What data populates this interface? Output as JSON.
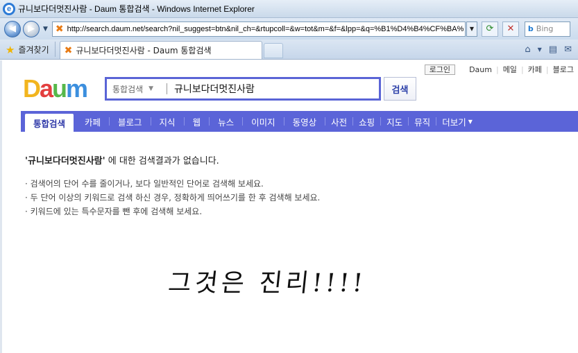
{
  "browser": {
    "window_title": "규니보다더멋진사람 - Daum 통합검색 - Windows Internet Explorer",
    "address": "http://search.daum.net/search?nil_suggest=btn&nil_ch=&rtupcoll=&w=tot&m=&f=&lpp=&q=%B1%D4%B4%CF%BA%",
    "search_placeholder": "Bing",
    "favorites_label": "즐겨찾기",
    "tab_title": "규니보다더멋진사람 - Daum 통합검색"
  },
  "header": {
    "login": "로그인",
    "links": [
      "Daum",
      "메일",
      "카페",
      "블로그"
    ]
  },
  "logo": {
    "letters": [
      "D",
      "a",
      "u",
      "m"
    ]
  },
  "search": {
    "scope": "통합검색",
    "query": "규니보다더멋진사람",
    "button": "검색"
  },
  "nav": {
    "active": "통합검색",
    "items": [
      "카페",
      "블로그",
      "지식",
      "웹",
      "뉴스",
      "이미지",
      "동영상",
      "사전",
      "쇼핑",
      "지도",
      "뮤직"
    ],
    "more": "더보기"
  },
  "result": {
    "query_quoted": "'규니보다더멋진사람'",
    "message": " 에 대한 검색결과가 없습니다.",
    "tips": [
      "· 검색어의 단어 수를 줄이거나, 보다 일반적인 단어로 검색해 보세요.",
      "· 두 단어 이상의 키워드로 검색 하신 경우, 정확하게 띄어쓰기를 한 후 검색해 보세요.",
      "· 키워드에 있는 특수문자를 뺀 후에 검색해 보세요."
    ]
  },
  "annotation": "그것은 진리!!!!",
  "colors": {
    "brand_blue": "#5b64d8",
    "search_border": "#5a64d6"
  }
}
